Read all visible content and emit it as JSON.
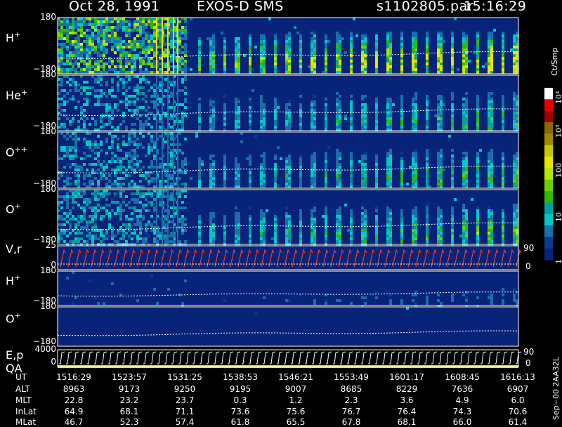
{
  "header": {
    "date": "Oct 28, 1991",
    "instrument": "EXOS-D SMS",
    "file": "s1102805.par",
    "time": "15:16:29"
  },
  "panels": [
    {
      "label_base": "H",
      "label_sup": "+",
      "ymax": "180",
      "ymin": "−180",
      "kind": "spectrogram",
      "intensity": 1.0
    },
    {
      "label_base": "He",
      "label_sup": "+",
      "ymax": "180",
      "ymin": "−180",
      "kind": "spectrogram",
      "intensity": 0.45
    },
    {
      "label_base": "O",
      "label_sup": "++",
      "ymax": "180",
      "ymin": "−180",
      "kind": "spectrogram",
      "intensity": 0.5
    },
    {
      "label_base": "O",
      "label_sup": "+",
      "ymax": "180",
      "ymin": "−180",
      "kind": "spectrogram",
      "intensity": 0.55
    },
    {
      "label_base": "V",
      "label_sup": "",
      "label_suffix": ",r",
      "ymax": "25",
      "ymin": "0",
      "right_top": "90",
      "right_bottom": "0",
      "kind": "vr"
    },
    {
      "label_base": "H",
      "label_sup": "+",
      "ymax": "180",
      "ymin": "−180",
      "kind": "spectrogram",
      "intensity": 0.15
    },
    {
      "label_base": "O",
      "label_sup": "+",
      "ymax": "180",
      "ymin": "−180",
      "kind": "spectrogram",
      "intensity": 0.05
    },
    {
      "label_base": "E,p",
      "label_sup": "",
      "label_line2": "QA",
      "ymax": "4000",
      "ymin": "0",
      "right_top": "90",
      "right_bottom": "0",
      "kind": "ep"
    }
  ],
  "colorbar": {
    "title": "Ct/Smp",
    "labels": [
      "10⁴",
      "10³",
      "100",
      "10",
      "1"
    ],
    "colors": [
      "#ffffff",
      "#e80000",
      "#a00000",
      "#8a6a00",
      "#a08a00",
      "#c8c800",
      "#e6e600",
      "#b4e600",
      "#6ecf00",
      "#2fb800",
      "#00a0a0",
      "#00c8c8",
      "#1a6eaa",
      "#0a3c8c",
      "#08247a"
    ]
  },
  "ephemeris": {
    "rows": [
      "UT",
      "ALT",
      "MLT",
      "InLat",
      "MLat"
    ],
    "columns": [
      [
        "1516:29",
        "8963",
        "22.8",
        "64.9",
        "46.7"
      ],
      [
        "1523:57",
        "9173",
        "23.2",
        "68.1",
        "52.3"
      ],
      [
        "1531:25",
        "9250",
        "23.7",
        "71.1",
        "57.4"
      ],
      [
        "1538:53",
        "9195",
        "0.3",
        "73.6",
        "61.8"
      ],
      [
        "1546:21",
        "9007",
        "1.2",
        "75.6",
        "65.5"
      ],
      [
        "1553:49",
        "8685",
        "2.3",
        "76.7",
        "67.8"
      ],
      [
        "1601:17",
        "8229",
        "3.6",
        "76.4",
        "68.1"
      ],
      [
        "1608:45",
        "7636",
        "4.9",
        "74.3",
        "66.0"
      ],
      [
        "1616:13",
        "6907",
        "6.0",
        "70.6",
        "61.4"
      ]
    ]
  },
  "footer": "Sep−00 2AA32L",
  "chart_data": {
    "type": "heatmap",
    "title": "EXOS-D SMS",
    "xlabel": "UT",
    "x": [
      "1516:29",
      "1523:57",
      "1531:25",
      "1538:53",
      "1546:21",
      "1553:49",
      "1601:17",
      "1608:45",
      "1616:13"
    ],
    "series": [
      {
        "name": "H+",
        "ylim": [
          -180,
          180
        ]
      },
      {
        "name": "He+",
        "ylim": [
          -180,
          180
        ]
      },
      {
        "name": "O++",
        "ylim": [
          -180,
          180
        ]
      },
      {
        "name": "O+",
        "ylim": [
          -180,
          180
        ]
      },
      {
        "name": "V,r",
        "ylim": [
          0,
          25
        ],
        "ylim_right": [
          0,
          90
        ]
      },
      {
        "name": "H+",
        "ylim": [
          -180,
          180
        ]
      },
      {
        "name": "O+",
        "ylim": [
          -180,
          180
        ]
      },
      {
        "name": "E,p QA",
        "ylim": [
          0,
          4000
        ],
        "ylim_right": [
          0,
          90
        ]
      }
    ],
    "colorbar": {
      "label": "Ct/Smp",
      "scale": "log",
      "range": [
        1,
        10000
      ]
    }
  }
}
